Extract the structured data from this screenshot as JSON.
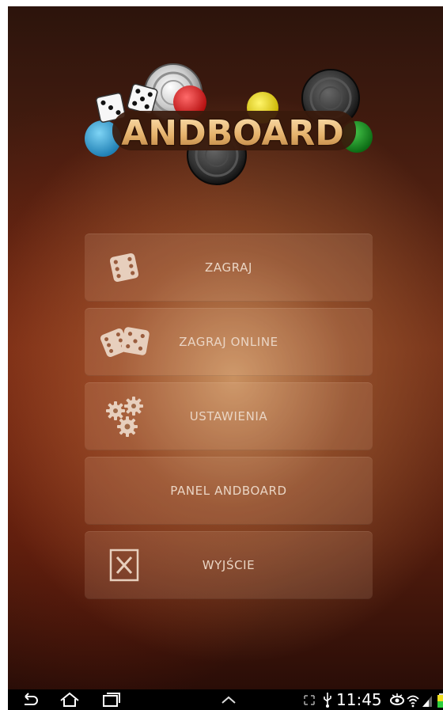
{
  "app": {
    "title": "ANDBOARD"
  },
  "menu": {
    "items": [
      {
        "id": "play",
        "label": "ZAGRAJ",
        "icon": "die-icon"
      },
      {
        "id": "play-online",
        "label": "ZAGRAJ ONLINE",
        "icon": "two-dice-icon"
      },
      {
        "id": "settings",
        "label": "USTAWIENIA",
        "icon": "gears-icon"
      },
      {
        "id": "panel",
        "label": "PANEL ANDBOARD",
        "icon": ""
      },
      {
        "id": "exit",
        "label": "WYJŚCIE",
        "icon": "exit-x-icon"
      }
    ]
  },
  "status_bar": {
    "time": "11:45",
    "icons": [
      "expand-icon",
      "usb-icon",
      "eye-icon",
      "wifi-icon",
      "signal-icon",
      "battery-icon"
    ]
  },
  "nav_bar": {
    "icons": [
      "back-icon",
      "home-icon",
      "recent-apps-icon",
      "up-chevron-icon"
    ]
  },
  "colors": {
    "menu_text": "#ead5c4",
    "logo_gold": "#f2c989",
    "logo_outline": "#3a1a0c"
  }
}
